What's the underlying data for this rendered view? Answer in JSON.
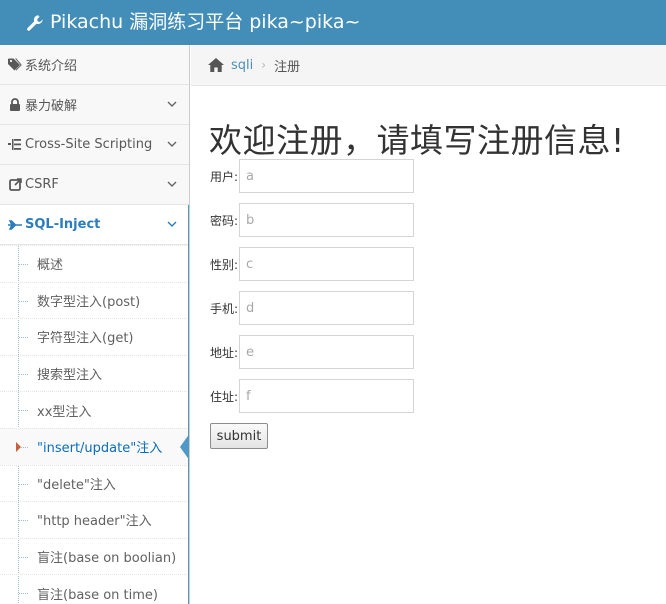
{
  "header": {
    "brand": "Pikachu 漏洞练习平台 pika~pika~",
    "icon": "wrench-icon",
    "bg_color": "#438eb9"
  },
  "sidebar": {
    "items": [
      {
        "label": "系统介绍",
        "icon": "tag-icon",
        "expanded": false
      },
      {
        "label": "暴力破解",
        "icon": "lock-icon",
        "expanded": false
      },
      {
        "label": "Cross-Site Scripting",
        "icon": "list-icon",
        "expanded": false
      },
      {
        "label": "CSRF",
        "icon": "share-icon",
        "expanded": false
      },
      {
        "label": "SQL-Inject",
        "icon": "plane-icon",
        "expanded": true
      }
    ],
    "sql_subitems": [
      "概述",
      "数字型注入(post)",
      "字符型注入(get)",
      "搜索型注入",
      "xx型注入",
      "\"insert/update\"注入",
      "\"delete\"注入",
      "\"http header\"注入",
      "盲注(base on boolian)",
      "盲注(base on time)"
    ],
    "active_subitem": "\"insert/update\"注入",
    "active_color": "#2b7dbc"
  },
  "breadcrumb": {
    "link": "sqli",
    "current": "注册",
    "separator": "›"
  },
  "main": {
    "title": "欢迎注册，请填写注册信息!",
    "fields": [
      {
        "label": "用户:",
        "placeholder": "a"
      },
      {
        "label": "密码:",
        "placeholder": "b"
      },
      {
        "label": "性别:",
        "placeholder": "c"
      },
      {
        "label": "手机:",
        "placeholder": "d"
      },
      {
        "label": "地址:",
        "placeholder": "e"
      },
      {
        "label": "住址:",
        "placeholder": "f"
      }
    ],
    "submit_label": "submit"
  }
}
